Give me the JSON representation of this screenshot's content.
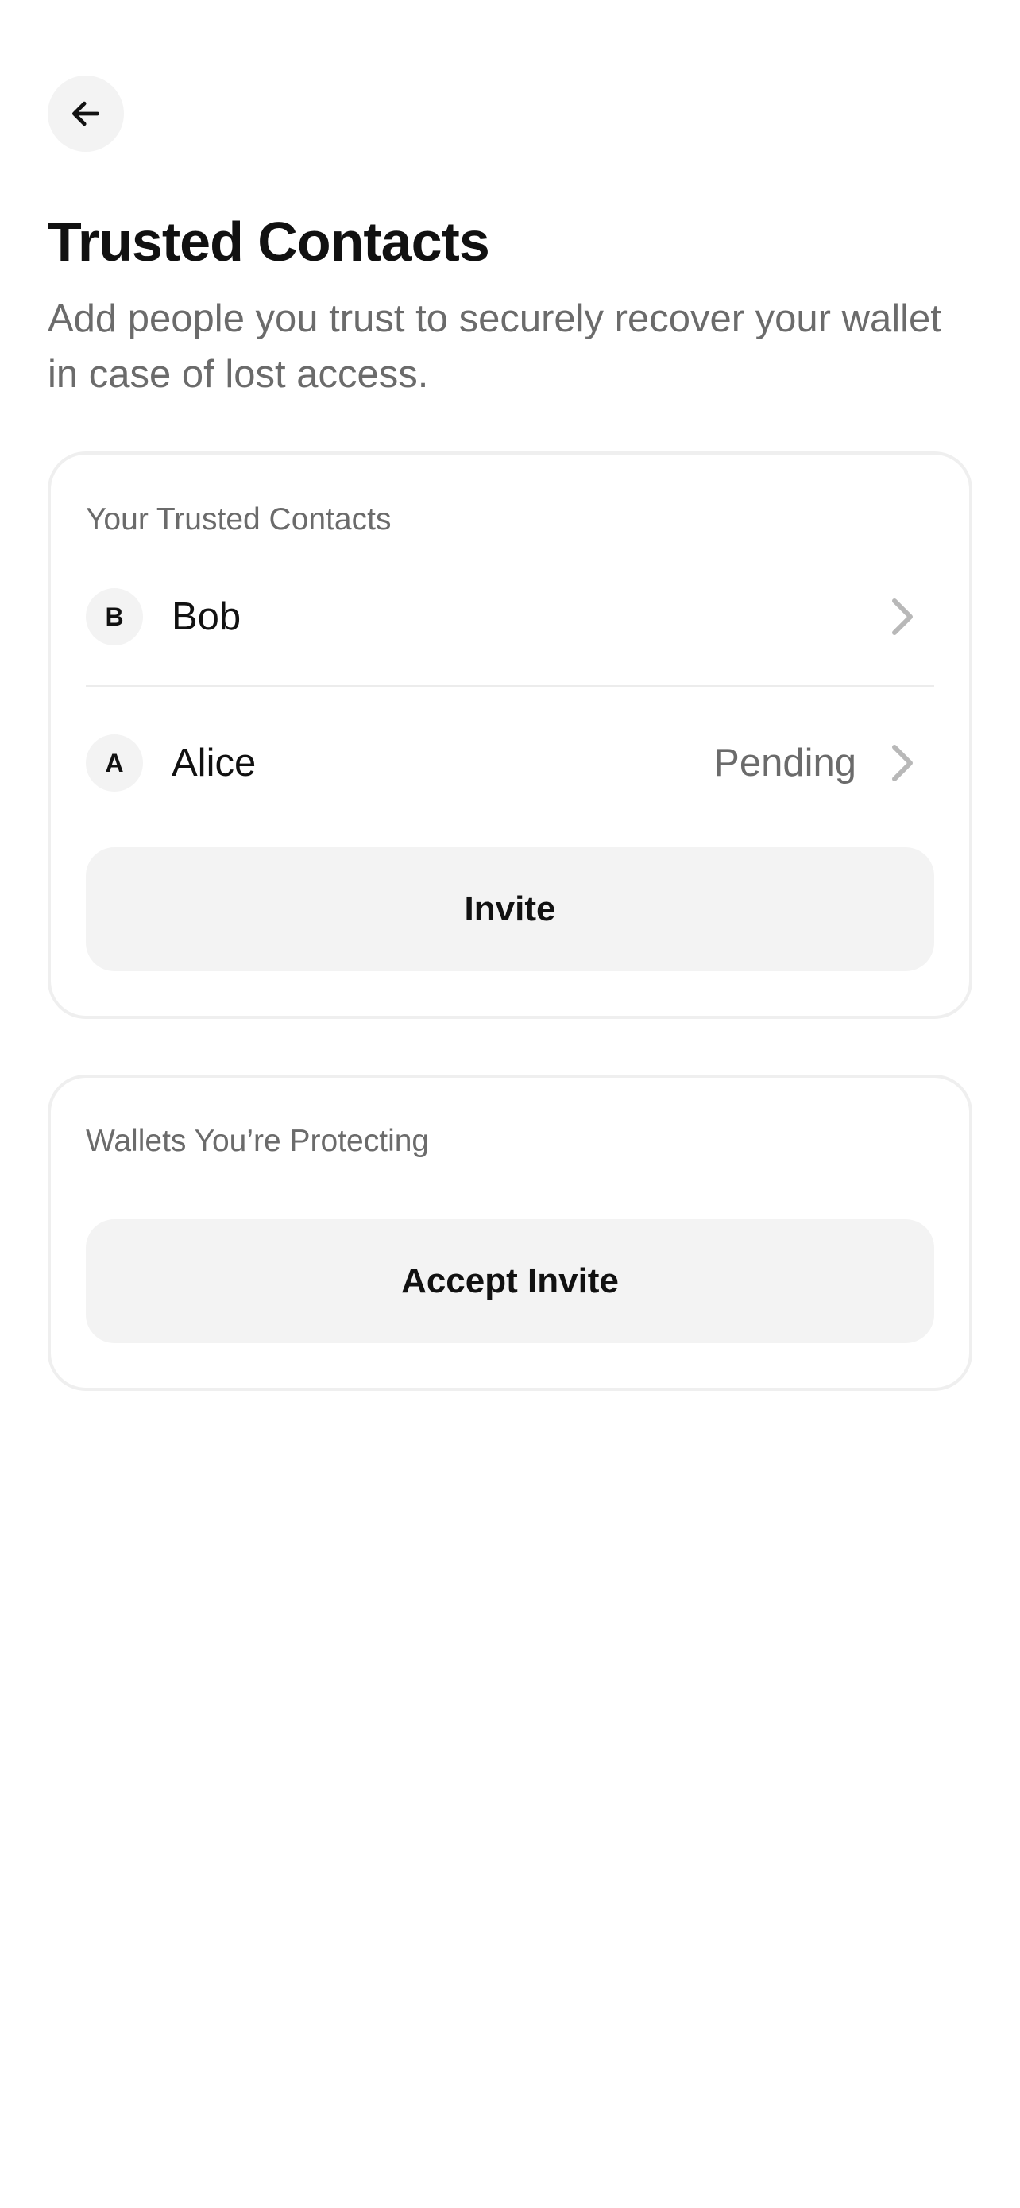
{
  "header": {
    "back_icon": "arrow-left-icon",
    "title": "Trusted Contacts",
    "subtitle": "Add people you trust to securely recover your wallet in case of lost access."
  },
  "trusted_contacts": {
    "heading": "Your Trusted Contacts",
    "contacts": [
      {
        "initial": "B",
        "name": "Bob",
        "status": "",
        "icon": "chevron-right-icon"
      },
      {
        "initial": "A",
        "name": "Alice",
        "status": "Pending",
        "icon": "chevron-right-icon"
      }
    ],
    "invite_label": "Invite"
  },
  "wallets_protecting": {
    "heading": "Wallets You’re Protecting",
    "accept_label": "Accept Invite"
  },
  "colors": {
    "text_primary": "#111111",
    "text_secondary": "#6b6b6b",
    "surface_muted": "#f3f3f3",
    "border": "#efefef",
    "chevron": "#b8b8b8"
  }
}
